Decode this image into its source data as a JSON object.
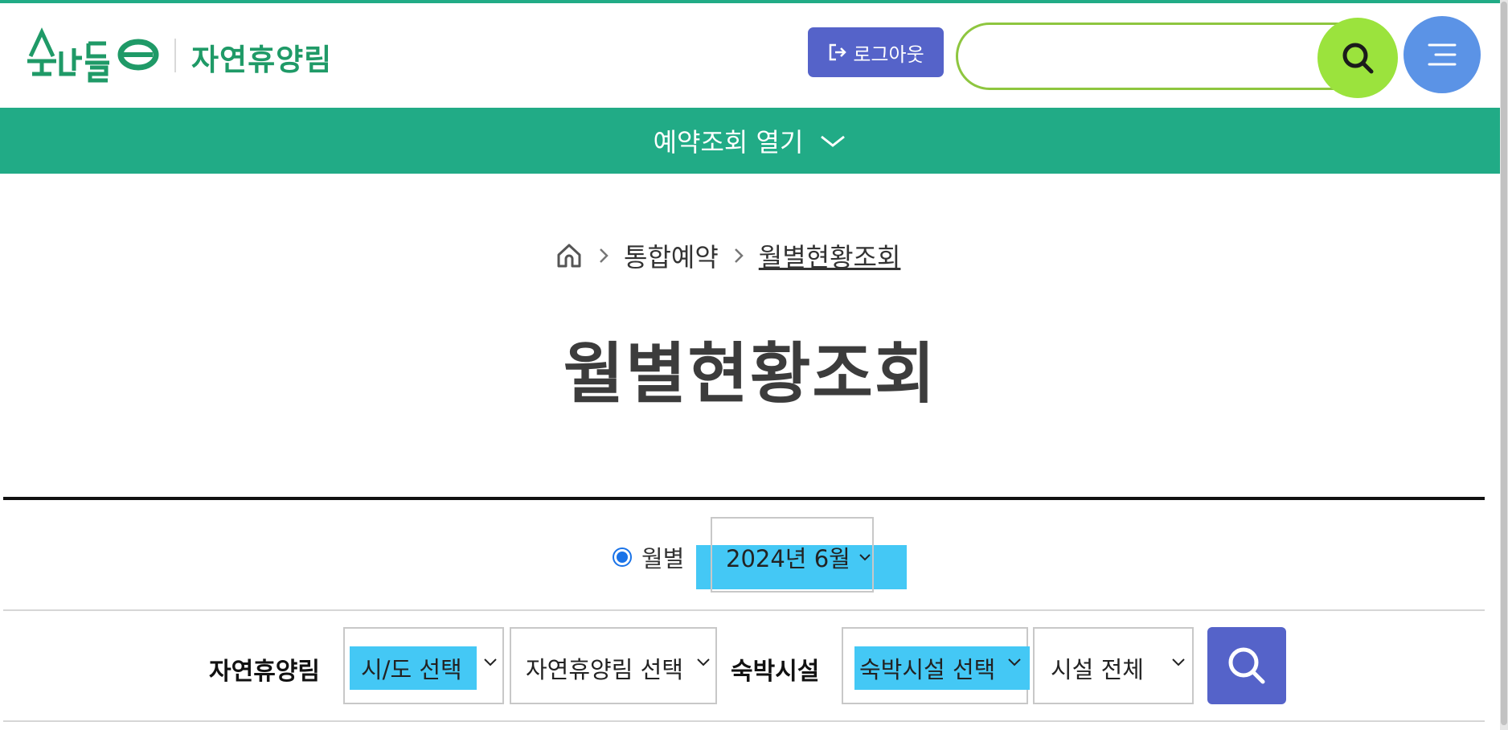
{
  "header": {
    "logo_text": "숲나들e",
    "site_name": "자연휴양림",
    "logout_label": "로그아웃",
    "search_placeholder": ""
  },
  "reservation_bar": {
    "label": "예약조회 열기"
  },
  "breadcrumb": {
    "items": [
      "통합예약",
      "월별현황조회"
    ]
  },
  "page_title": "월별현황조회",
  "filter": {
    "mode_label": "월별",
    "month_value": "2024년 6월"
  },
  "search_row": {
    "forest_label": "자연휴양림",
    "region_select": "시/도 선택",
    "forest_select": "자연휴양림 선택",
    "lodging_label": "숙박시설",
    "lodging_select": "숙박시설 선택",
    "facility_select": "시설 전체"
  },
  "colors": {
    "brand_green": "#21ab86",
    "logout_blue": "#5563c9",
    "search_green": "#9be33d",
    "menu_blue": "#5b93e6",
    "highlight": "#44c8f5"
  }
}
